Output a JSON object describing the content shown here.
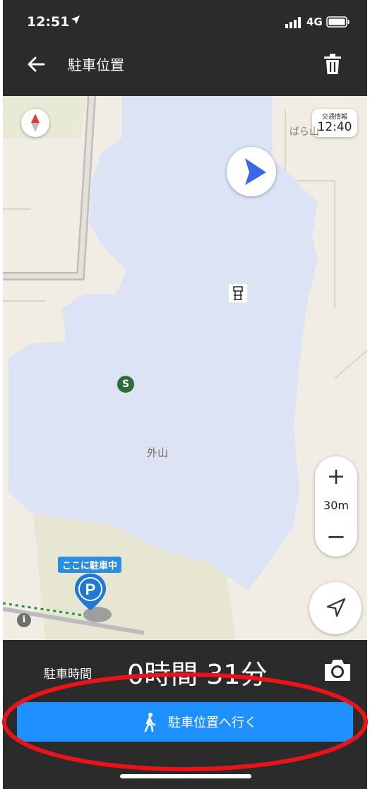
{
  "status_bar": {
    "time": "12:51",
    "network": "4G"
  },
  "header": {
    "title": "駐車位置"
  },
  "map": {
    "traffic_label": "交通情報",
    "traffic_time": "12:40",
    "place_bara": "ばら山",
    "area_label": "外山",
    "zoom_scale": "30m",
    "zoom_in": "+",
    "zoom_out": "−",
    "parked_label": "ここに駐車中",
    "info": "i",
    "poi_s": "S"
  },
  "panel": {
    "parking_time_label": "駐車時間",
    "parking_time_value": "0時間 31分",
    "go_button_label": "駐車位置へ行く"
  },
  "colors": {
    "accent": "#1e90ff",
    "header_bg": "#2b2b2b",
    "building": "#dbe3f4",
    "annotation": "#e8141a"
  }
}
